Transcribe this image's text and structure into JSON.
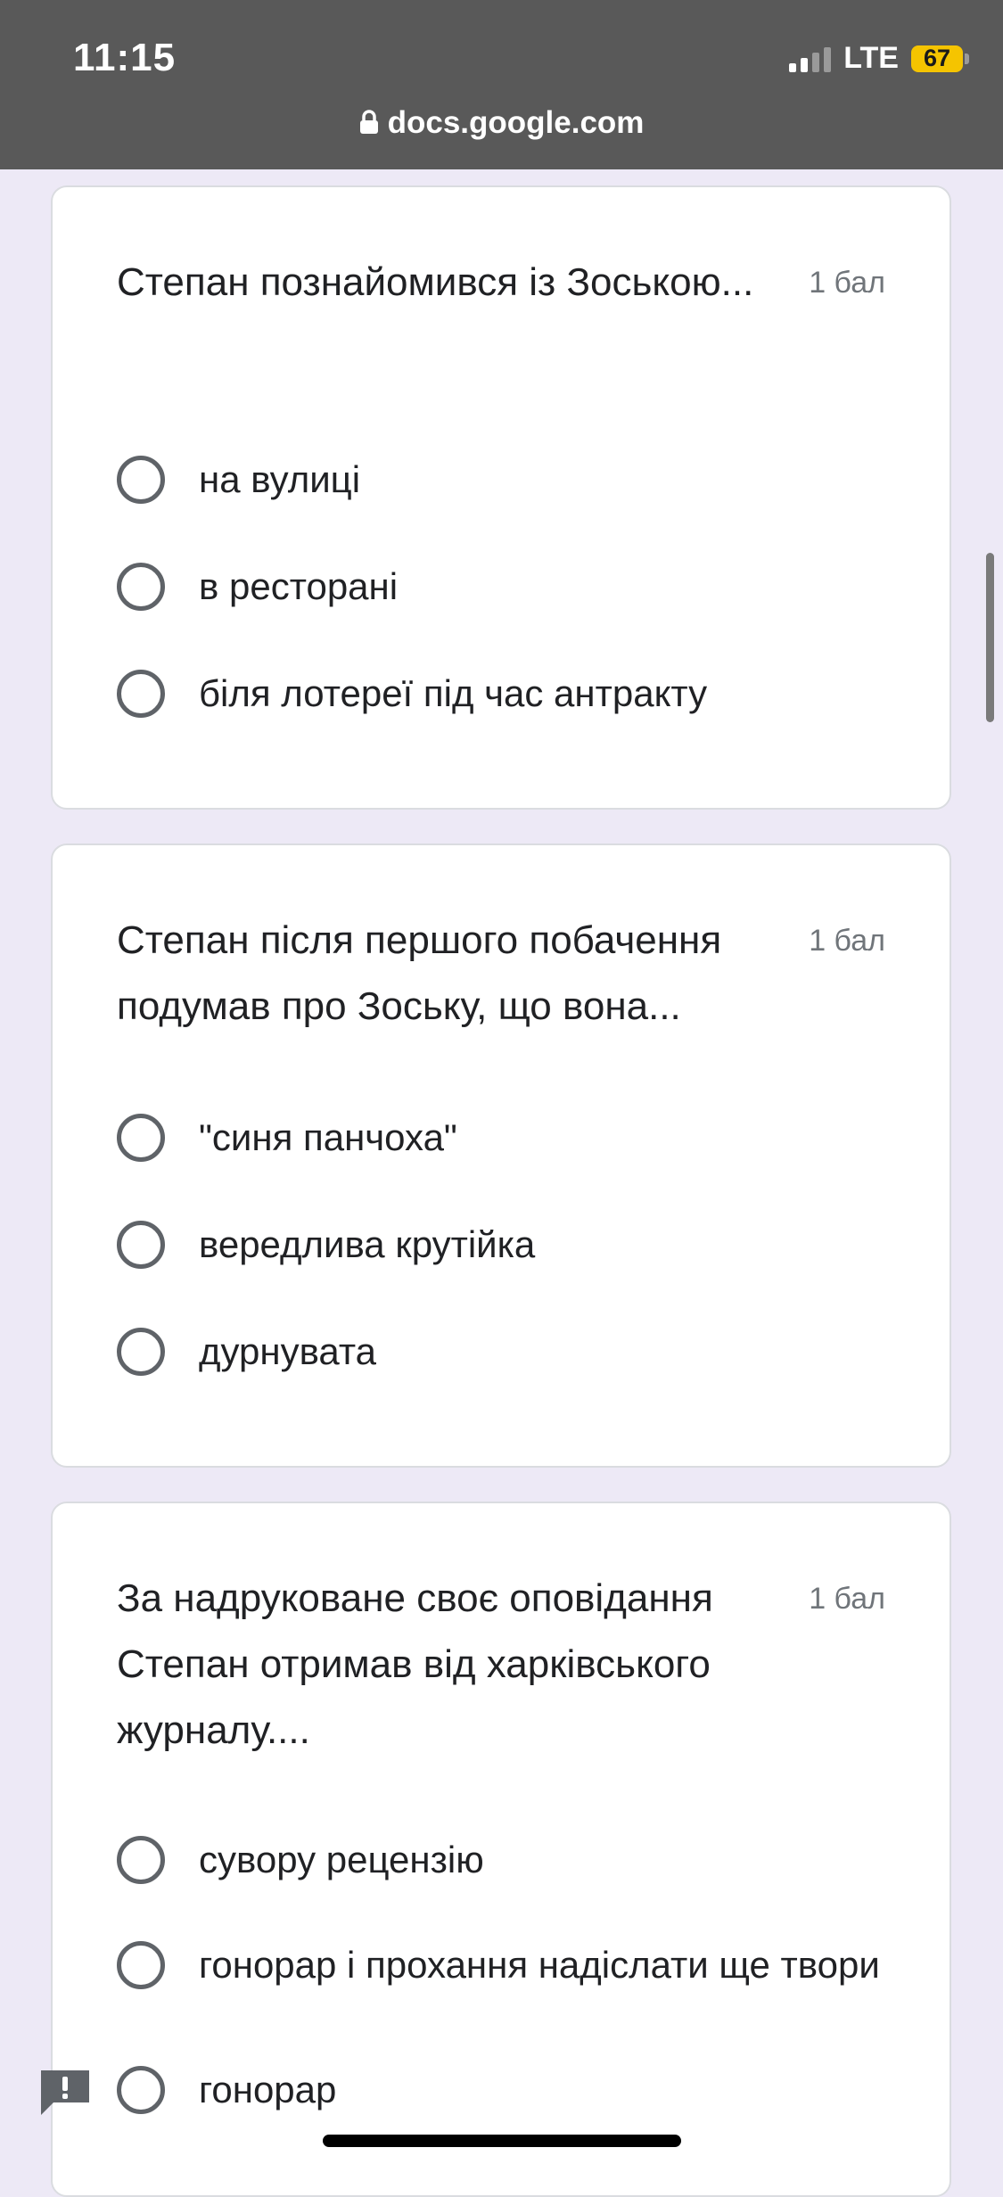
{
  "status_bar": {
    "time": "11:15",
    "network": "LTE",
    "battery": "67"
  },
  "browser": {
    "url": "docs.google.com"
  },
  "questions": [
    {
      "title": "Степан познайомився із Зоською...",
      "points": "1 бал",
      "options": [
        "на вулиці",
        "в ресторані",
        "біля лотереї під час антракту"
      ]
    },
    {
      "title": "Степан після першого побачення подумав про  Зоську, що  вона...",
      "points": "1 бал",
      "options": [
        "\"синя панчоха\"",
        "вередлива крутійка",
        "дурнувата"
      ]
    },
    {
      "title": "За  надруковане своє оповідання  Степан отримав від харківського  журналу....",
      "points": "1 бал",
      "options": [
        "сувору  рецензію",
        "гонорар  і прохання надіслати ще твори",
        "гонорар"
      ]
    }
  ],
  "icons": {
    "lock": "lock-icon",
    "feedback": "report-issue-icon",
    "radio": "radio-unchecked-icon"
  },
  "colors": {
    "page_background": "#ede9f6",
    "status_bar": "#595959",
    "battery": "#f5c400",
    "radio": "#5f6368"
  }
}
